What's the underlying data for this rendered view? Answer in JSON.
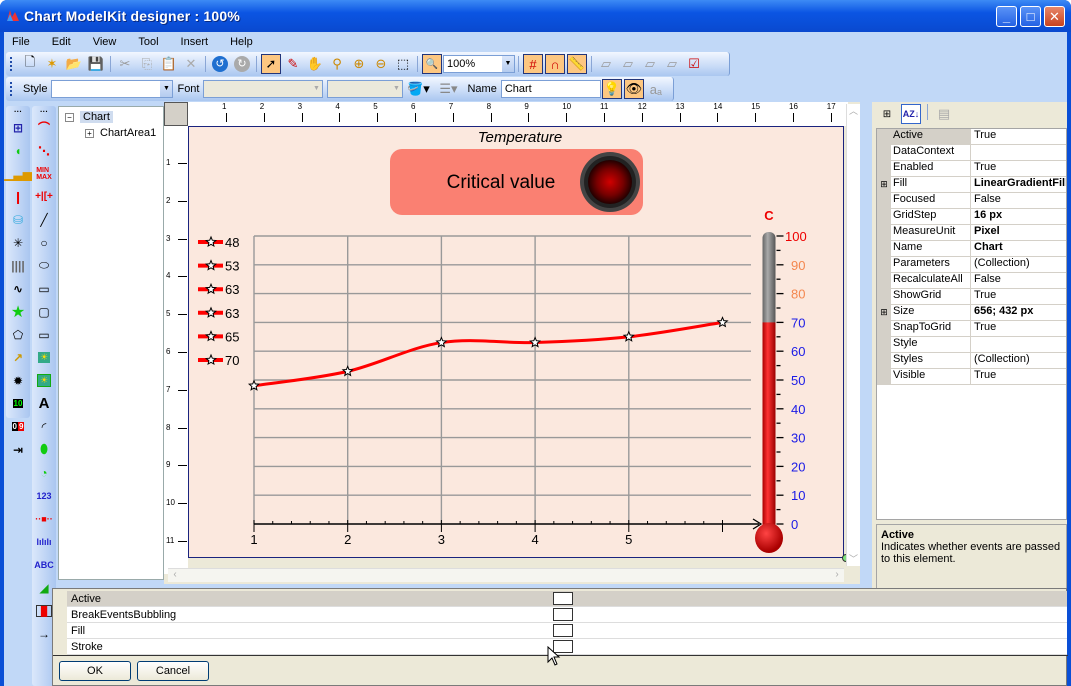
{
  "window": {
    "title": "Chart ModelKit designer : 100%"
  },
  "menu": [
    "File",
    "Edit",
    "View",
    "Tool",
    "Insert",
    "Help"
  ],
  "toolbar": {
    "zoom_value": "100%",
    "style_label": "Style",
    "style_value": "",
    "font_label": "Font",
    "name_label": "Name",
    "name_value": "Chart"
  },
  "tree": {
    "root": "Chart",
    "child": "ChartArea1"
  },
  "ruler": {
    "top": [
      "1",
      "2",
      "3",
      "4",
      "5",
      "6",
      "7",
      "8",
      "9",
      "10",
      "11",
      "12",
      "13",
      "14",
      "15",
      "16",
      "17"
    ],
    "left": [
      "1",
      "2",
      "3",
      "4",
      "5",
      "6",
      "7",
      "8",
      "9",
      "10",
      "11"
    ]
  },
  "chart_data": {
    "type": "line",
    "title": "Temperature",
    "x": [
      1,
      2,
      3,
      4,
      5,
      6
    ],
    "x_ticks": [
      "1",
      "2",
      "3",
      "4",
      "5"
    ],
    "series": [
      {
        "name": "Temperature",
        "values": [
          48,
          53,
          63,
          63,
          65,
          70
        ],
        "color": "#ff0000"
      }
    ],
    "legend_values": [
      "48",
      "53",
      "63",
      "63",
      "65",
      "70"
    ],
    "ylim": [
      0,
      100
    ],
    "grid": true,
    "legend": "left",
    "indicator": {
      "label": "Critical value",
      "state": "on"
    },
    "thermometer": {
      "unit": "C",
      "value": 70,
      "ticks": [
        "100",
        "90",
        "80",
        "70",
        "60",
        "50",
        "40",
        "30",
        "20",
        "10",
        "0"
      ]
    }
  },
  "properties": {
    "rows": [
      {
        "name": "Active",
        "value": "True",
        "bold": false,
        "expand": false
      },
      {
        "name": "DataContext",
        "value": "",
        "bold": false,
        "expand": false
      },
      {
        "name": "Enabled",
        "value": "True",
        "bold": false,
        "expand": false
      },
      {
        "name": "Fill",
        "value": "LinearGradientFill",
        "bold": true,
        "expand": true
      },
      {
        "name": "Focused",
        "value": "False",
        "bold": false,
        "expand": false
      },
      {
        "name": "GridStep",
        "value": "16 px",
        "bold": true,
        "expand": false
      },
      {
        "name": "MeasureUnit",
        "value": "Pixel",
        "bold": true,
        "expand": false
      },
      {
        "name": "Name",
        "value": "Chart",
        "bold": true,
        "expand": false
      },
      {
        "name": "Parameters",
        "value": "(Collection)",
        "bold": false,
        "expand": false
      },
      {
        "name": "RecalculateAll",
        "value": "False",
        "bold": false,
        "expand": false
      },
      {
        "name": "ShowGrid",
        "value": "True",
        "bold": false,
        "expand": false
      },
      {
        "name": "Size",
        "value": "656; 432 px",
        "bold": true,
        "expand": true
      },
      {
        "name": "SnapToGrid",
        "value": "True",
        "bold": false,
        "expand": false
      },
      {
        "name": "Style",
        "value": "",
        "bold": false,
        "expand": false
      },
      {
        "name": "Styles",
        "value": "(Collection)",
        "bold": false,
        "expand": false
      },
      {
        "name": "Visible",
        "value": "True",
        "bold": false,
        "expand": false
      }
    ],
    "desc_title": "Active",
    "desc_text": "Indicates whether events are passed to this element."
  },
  "events": {
    "rows": [
      "Active",
      "BreakEventsBubbling",
      "Fill",
      "Stroke"
    ],
    "ok_label": "OK",
    "cancel_label": "Cancel"
  }
}
